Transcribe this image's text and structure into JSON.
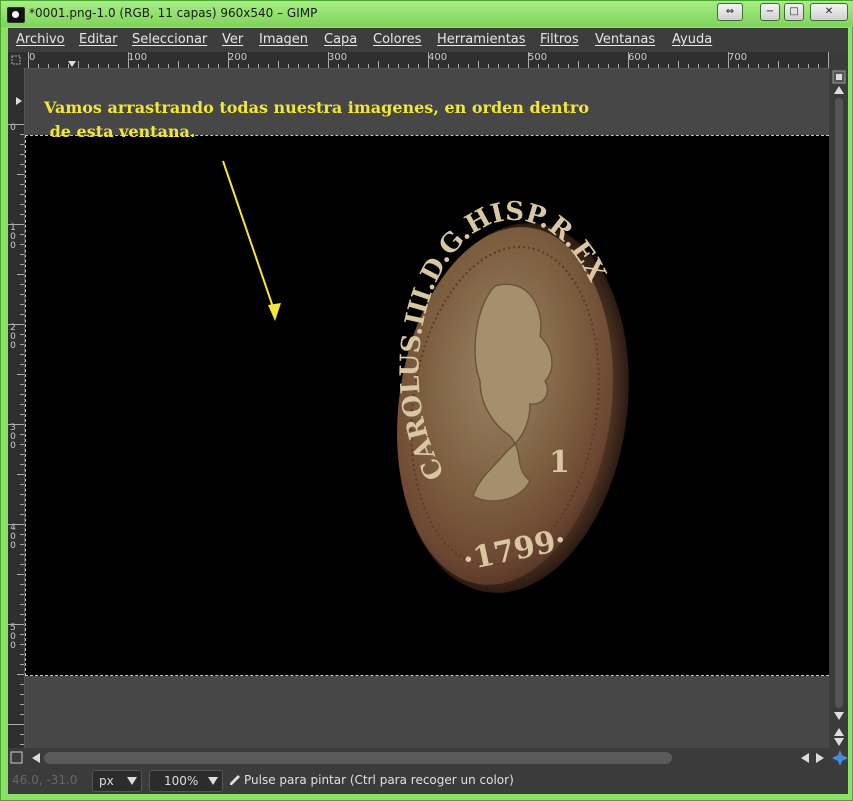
{
  "window": {
    "title": "*0001.png-1.0 (RGB, 11 capas) 960x540 – GIMP",
    "controls": [
      "⇔",
      "−",
      "□",
      "✕"
    ]
  },
  "menu": [
    "Archivo",
    "Editar",
    "Seleccionar",
    "Ver",
    "Imagen",
    "Capa",
    "Colores",
    "Herramientas",
    "Filtros",
    "Ventanas",
    "Ayuda"
  ],
  "ruler_h_labels": [
    "0",
    "100",
    "200",
    "300",
    "400",
    "500",
    "600",
    "700"
  ],
  "ruler_v_labels": [
    "0",
    "1\n0\n0",
    "2\n0\n0",
    "3\n0\n0",
    "4\n0\n0",
    "5\n0\n0"
  ],
  "canvas": {
    "annotation_text": "Vamos arrastrando todas nuestra imagenes, en orden dentro\n de esta ventana.",
    "coin_legend_top": "CAROLUS.III.D.G.HISP.R.EX",
    "coin_year": "·1799·",
    "coin_value": "1",
    "colors": {
      "annotation": "#f2e63a",
      "guide": "#d8d060",
      "coin": "#8a6a45"
    }
  },
  "status": {
    "coordinates": "46.0, -31.0",
    "unit": "px",
    "zoom": "100%",
    "message": "Pulse para pintar (Ctrl para recoger un color)",
    "icons": [
      "pen-icon",
      "navigate-icon"
    ]
  }
}
